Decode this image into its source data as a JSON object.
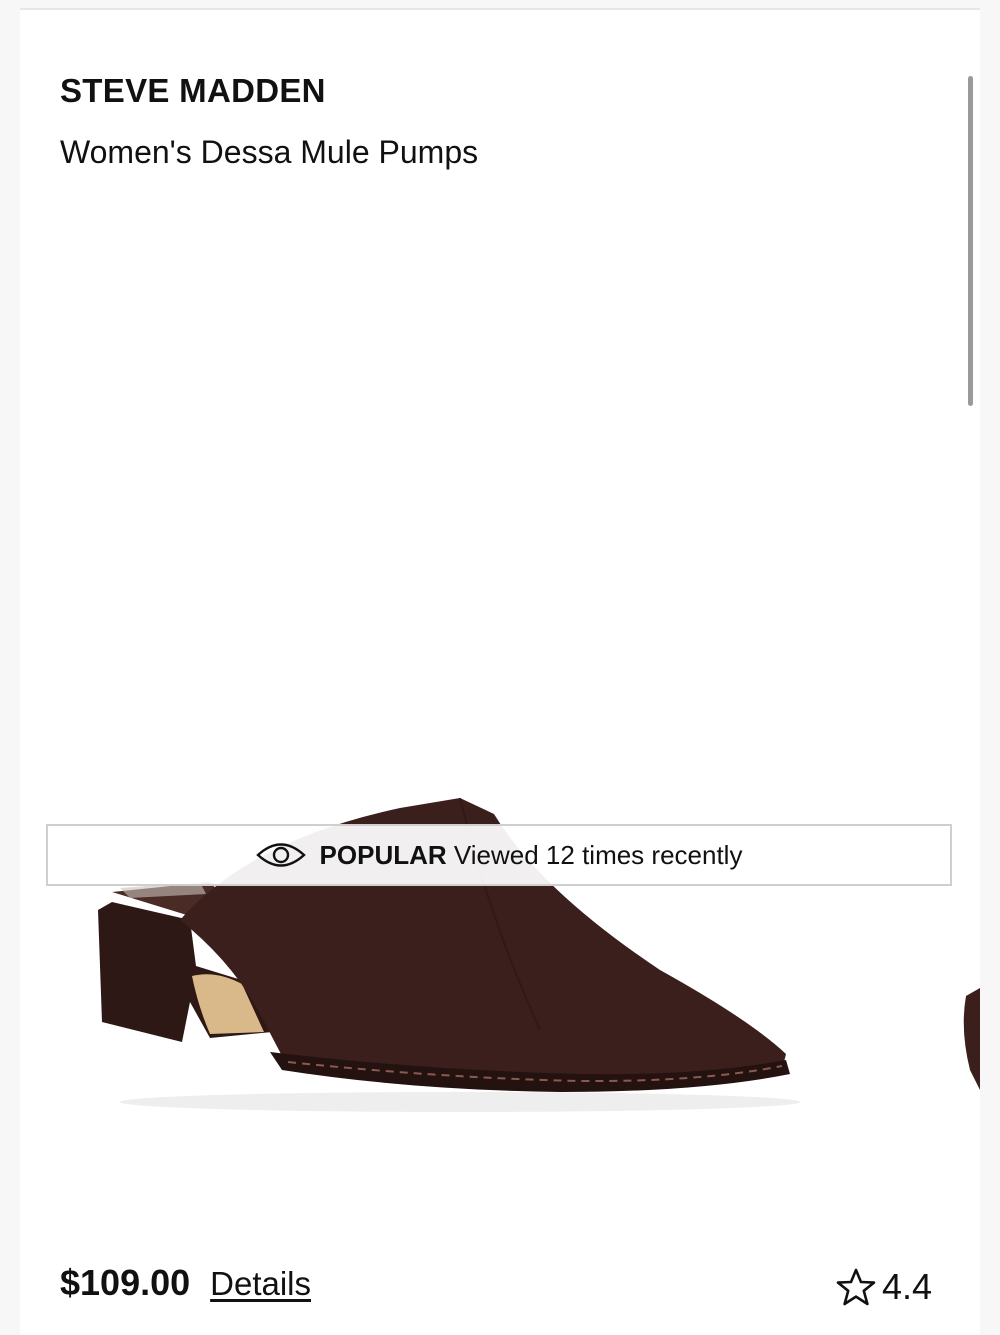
{
  "product": {
    "brand": "STEVE MADDEN",
    "name": "Women's Dessa Mule Pumps",
    "price": "$109.00",
    "details_label": "Details",
    "rating": "4.4",
    "image_color": "#3a1f1c"
  },
  "banner": {
    "icon": "eye-icon",
    "label": "POPULAR",
    "text": "Viewed 12 times recently"
  },
  "icons": {
    "rating": "star-outline-icon"
  }
}
